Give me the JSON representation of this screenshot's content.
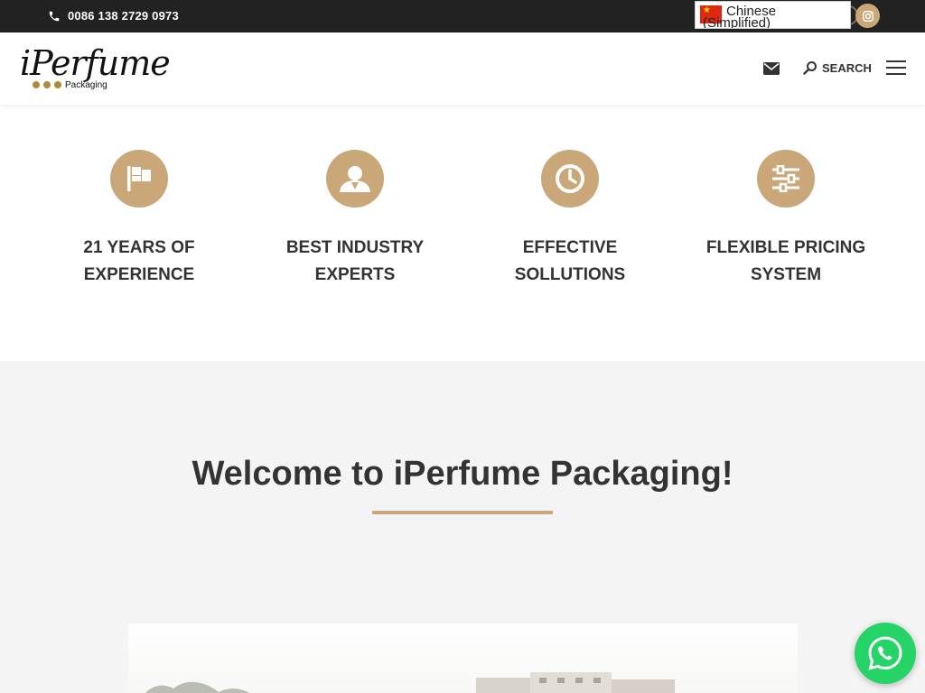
{
  "topbar": {
    "phone": "0086 138 2729 0973",
    "language": "Chinese (Simplified)",
    "social": [
      "instagram-icon"
    ]
  },
  "header": {
    "logo_text": "iPerfume",
    "logo_sub": "Packaging",
    "search_label": "SEARCH"
  },
  "features": [
    {
      "icon": "flag-icon",
      "label": "21 YEARS OF EXPERIENCE"
    },
    {
      "icon": "user-icon",
      "label": "BEST INDUSTRY EXPERTS"
    },
    {
      "icon": "clock-icon",
      "label": "EFFECTIVE SOLLUTIONS"
    },
    {
      "icon": "sliders-icon",
      "label": "FLEXIBLE PRICING SYSTEM"
    }
  ],
  "welcome": {
    "title": "Welcome to iPerfume Packaging!"
  },
  "colors": {
    "accent": "#c9a779",
    "topbar_bg": "#222222",
    "section_bg": "#f4f4f4",
    "whatsapp": "#25d366"
  }
}
